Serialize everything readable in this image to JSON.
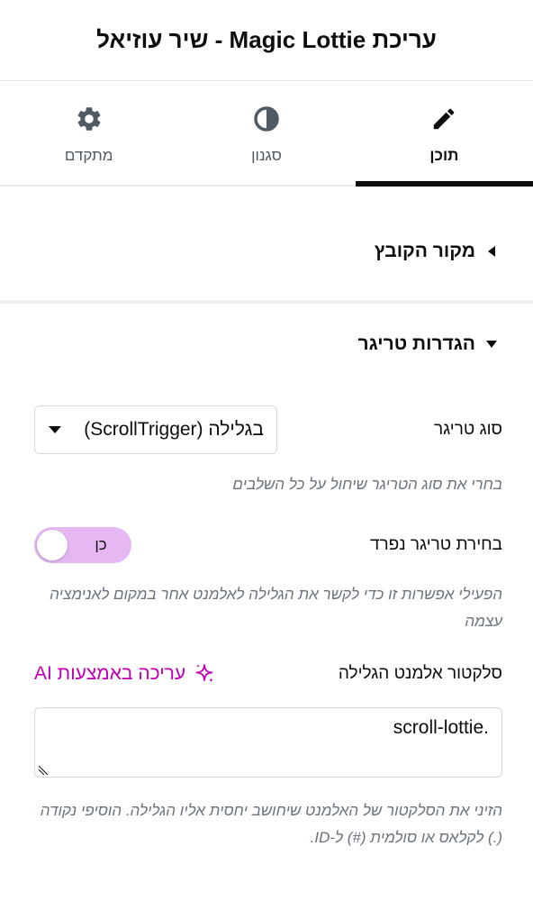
{
  "header": {
    "title": "עריכת Magic Lottie - שיר עוזיאל"
  },
  "tabs": [
    {
      "label": "תוכן",
      "icon": "pencil-icon",
      "active": true
    },
    {
      "label": "סגנון",
      "icon": "half-circle-icon",
      "active": false
    },
    {
      "label": "מתקדם",
      "icon": "gear-icon",
      "active": false
    }
  ],
  "sections": {
    "file_source": {
      "title": "מקור הקובץ",
      "expanded": false
    },
    "trigger_settings": {
      "title": "הגדרות טריגר",
      "expanded": true
    }
  },
  "trigger_type": {
    "label": "סוג טריגר",
    "value": "בגלילה (ScrollTrigger)",
    "help": "בחרי את סוג הטריגר שיחול על כל השלבים"
  },
  "separate_trigger": {
    "label": "בחירת טריגר נפרד",
    "toggle_text": "כן",
    "help": "הפעילי אפשרות זו כדי לקשר את הגלילה לאלמנט אחר במקום לאנימציה עצמה"
  },
  "scroll_selector": {
    "label": "סלקטור אלמנט הגלילה",
    "ai_label": "עריכה באמצעות AI",
    "value": ".scroll-lottie",
    "help": "הזיני את הסלקטור של האלמנט שיחושב יחסית אליו הגלילה. הוסיפי נקודה (.) לקלאס או סולמית (#) ל-ID."
  },
  "colors": {
    "accent": "#c000b3",
    "toggle_bg": "#e5b8f4",
    "text": "#0c0d0e",
    "muted": "#69727d"
  }
}
